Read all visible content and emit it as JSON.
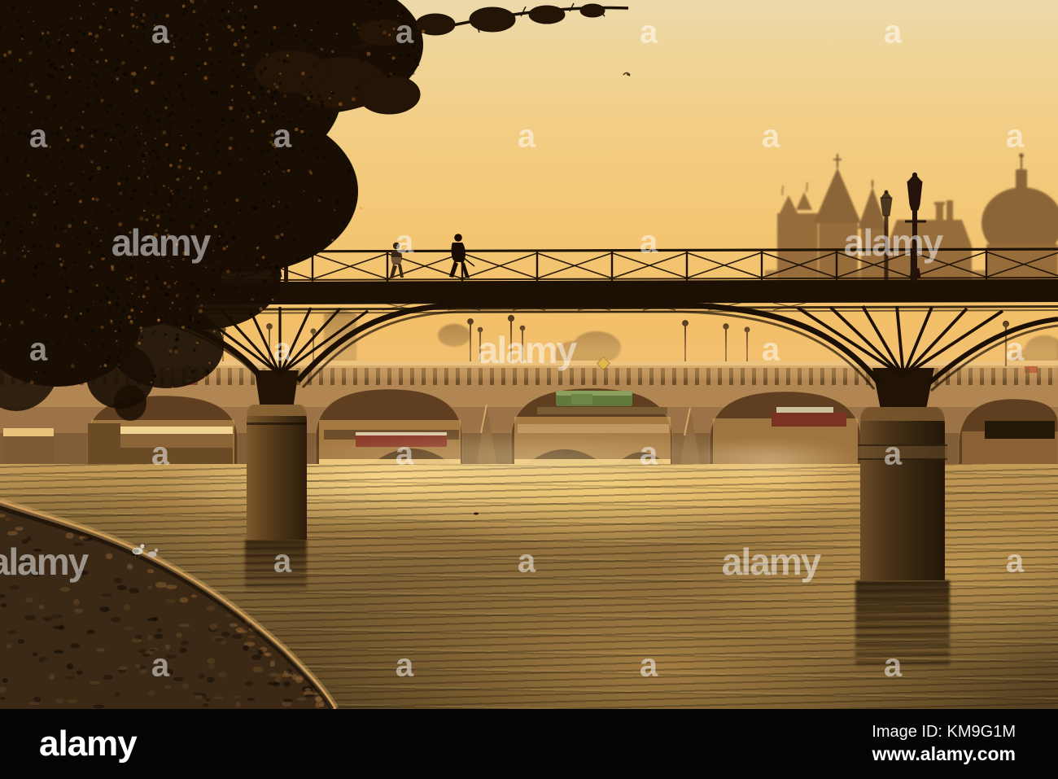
{
  "footer": {
    "logo": "alamy",
    "image_id": "Image ID: KM9G1M",
    "website": "www.alamy.com"
  },
  "watermark": {
    "small": "a",
    "large": "alamy"
  },
  "scene": {
    "description": "Golden sunrise over the Seine, Paris: Pont des Arts footbridge with two silhouetted pedestrians and candelabra lamps, Pont Neuf stone arches behind, skyline with conical towers and a dome, autumn tree overhanging a cobbled quay, sun-glittered water",
    "colors": {
      "sky_top": "#ecd9ab",
      "sky_horizon": "#efb35a",
      "water_gold": "#c59c58",
      "water_dark": "#54401f",
      "silhouette": "#1c0f04",
      "stone": "#b18653",
      "footer_bar": "#040404",
      "watermark": "rgba(255,255,255,0.5)"
    }
  }
}
